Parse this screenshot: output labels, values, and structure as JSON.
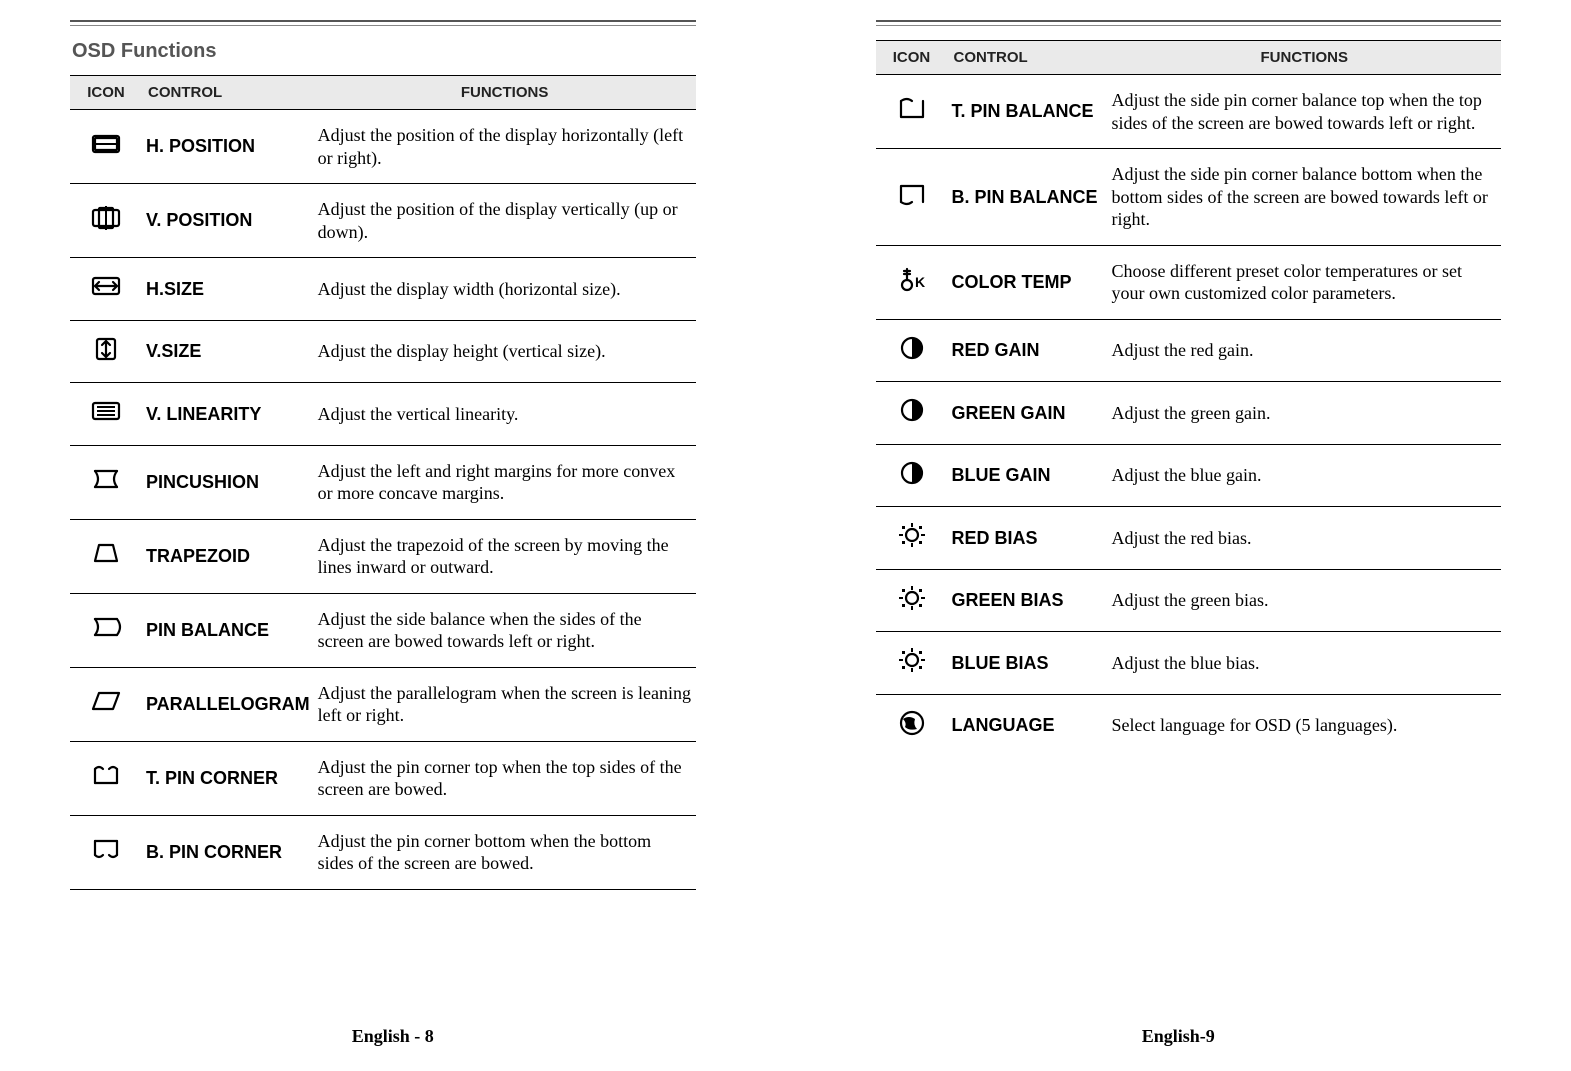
{
  "section_title": "OSD Functions",
  "headers": {
    "icon": "ICON",
    "control": "CONTROL",
    "functions": "FUNCTIONS"
  },
  "left": {
    "rows": [
      {
        "icon": "h-position-icon",
        "control": "H. POSITION",
        "func": "Adjust the position of the display horizontally (left or right)."
      },
      {
        "icon": "v-position-icon",
        "control": "V. POSITION",
        "func": "Adjust the position of the display vertically (up or down)."
      },
      {
        "icon": "h-size-icon",
        "control": "H.SIZE",
        "func": "Adjust the display width (horizontal size)."
      },
      {
        "icon": "v-size-icon",
        "control": "V.SIZE",
        "func": "Adjust the display height (vertical size)."
      },
      {
        "icon": "v-linearity-icon",
        "control": "V. LINEARITY",
        "func": "Adjust the vertical linearity."
      },
      {
        "icon": "pincushion-icon",
        "control": "PINCUSHION",
        "func": "Adjust the left and right margins for more convex or more concave margins."
      },
      {
        "icon": "trapezoid-icon",
        "control": "TRAPEZOID",
        "func": "Adjust the trapezoid of the screen by moving the lines inward or outward."
      },
      {
        "icon": "pin-balance-icon",
        "control": "PIN BALANCE",
        "func": "Adjust the side balance when the sides of the screen are bowed towards left or right."
      },
      {
        "icon": "parallelogram-icon",
        "control": "PARALLELOGRAM",
        "func": "Adjust the parallelogram when the screen is leaning left or right."
      },
      {
        "icon": "t-pin-corner-icon",
        "control": "T. PIN CORNER",
        "func": "Adjust the pin corner top when the top sides of the screen are bowed."
      },
      {
        "icon": "b-pin-corner-icon",
        "control": "B. PIN CORNER",
        "func": "Adjust the pin corner bottom when the bottom sides of the screen are bowed."
      }
    ],
    "footer": "English - 8"
  },
  "right": {
    "rows": [
      {
        "icon": "t-pin-balance-icon",
        "control": "T. PIN BALANCE",
        "func": "Adjust the side pin corner balance top when the top sides of the screen are bowed towards left or right."
      },
      {
        "icon": "b-pin-balance-icon",
        "control": "B. PIN BALANCE",
        "func": "Adjust the side pin corner balance bottom when the bottom sides of the screen are bowed towards left or right."
      },
      {
        "icon": "color-temp-icon",
        "control": "COLOR TEMP",
        "func": "Choose different preset color temperatures or set your own customized color parameters."
      },
      {
        "icon": "red-gain-icon",
        "control": "RED GAIN",
        "func": "Adjust the red gain."
      },
      {
        "icon": "green-gain-icon",
        "control": "GREEN GAIN",
        "func": "Adjust the green gain."
      },
      {
        "icon": "blue-gain-icon",
        "control": "BLUE GAIN",
        "func": "Adjust the blue gain."
      },
      {
        "icon": "red-bias-icon",
        "control": "RED BIAS",
        "func": "Adjust the red bias."
      },
      {
        "icon": "green-bias-icon",
        "control": "GREEN BIAS",
        "func": "Adjust the green bias."
      },
      {
        "icon": "blue-bias-icon",
        "control": "BLUE BIAS",
        "func": "Adjust the blue bias."
      },
      {
        "icon": "language-icon",
        "control": "LANGUAGE",
        "func": "Select language for OSD (5 languages)."
      }
    ],
    "footer": "English-9"
  }
}
